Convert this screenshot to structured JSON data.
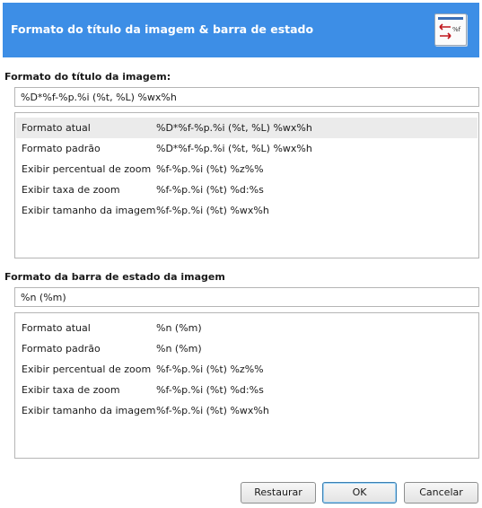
{
  "dialog": {
    "title": "Formato do título da imagem & barra de estado",
    "icon": "title-format-icon",
    "icon_text": "%f",
    "accent_color": "#3d8ee6"
  },
  "title_section": {
    "label": "Formato do título da imagem:",
    "value": "%D*%f-%p.%i (%t, %L) %wx%h",
    "rows": [
      {
        "key": "Formato atual",
        "value": "%D*%f-%p.%i (%t, %L) %wx%h"
      },
      {
        "key": "Formato padrão",
        "value": "%D*%f-%p.%i (%t, %L) %wx%h"
      },
      {
        "key": "Exibir percentual de zoom",
        "value": "%f-%p.%i (%t) %z%%"
      },
      {
        "key": "Exibir taxa de zoom",
        "value": "%f-%p.%i (%t) %d:%s"
      },
      {
        "key": "Exibir tamanho da imagem",
        "value": "%f-%p.%i (%t) %wx%h"
      }
    ]
  },
  "status_section": {
    "label": "Formato da barra de estado da imagem",
    "value": "%n (%m)",
    "rows": [
      {
        "key": "Formato atual",
        "value": "%n (%m)"
      },
      {
        "key": "Formato padrão",
        "value": "%n (%m)"
      },
      {
        "key": "Exibir percentual de zoom",
        "value": "%f-%p.%i (%t) %z%%"
      },
      {
        "key": "Exibir taxa de zoom",
        "value": "%f-%p.%i (%t) %d:%s"
      },
      {
        "key": "Exibir tamanho da imagem",
        "value": "%f-%p.%i (%t) %wx%h"
      }
    ]
  },
  "buttons": {
    "restore": "Restaurar",
    "ok": "OK",
    "cancel": "Cancelar"
  }
}
